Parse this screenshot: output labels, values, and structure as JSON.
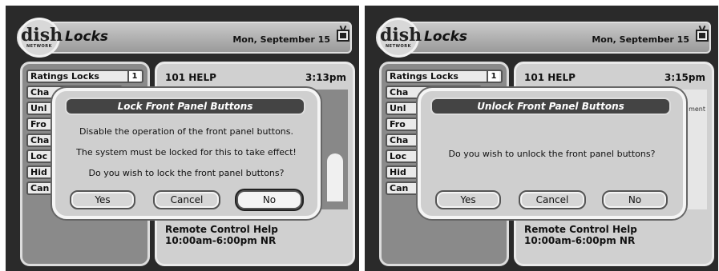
{
  "left": {
    "title": "Locks",
    "date": "Mon, September 15",
    "menu": [
      {
        "label": "Ratings Locks",
        "num": "1"
      },
      {
        "label": "Cha"
      },
      {
        "label": "Unl"
      },
      {
        "label": "Fro"
      },
      {
        "label": "Cha"
      },
      {
        "label": "Loc"
      },
      {
        "label": "Hid"
      },
      {
        "label": "Can"
      }
    ],
    "help": {
      "title": "101 HELP",
      "time": "3:13pm",
      "bottom_line1": "Remote Control Help",
      "bottom_line2": "10:00am-6:00pm NR"
    },
    "dialog": {
      "title": "Lock Front Panel Buttons",
      "line1": "Disable the operation of the front panel buttons.",
      "line2": "The system must be locked for this to take effect!",
      "line3": "Do you wish to lock the front panel buttons?",
      "yes": "Yes",
      "cancel": "Cancel",
      "no": "No"
    }
  },
  "right": {
    "title": "Locks",
    "date": "Mon, September 15",
    "menu": [
      {
        "label": "Ratings Locks",
        "num": "1"
      },
      {
        "label": "Cha"
      },
      {
        "label": "Unl"
      },
      {
        "label": "Fro"
      },
      {
        "label": "Cha"
      },
      {
        "label": "Loc"
      },
      {
        "label": "Hid"
      },
      {
        "label": "Can"
      }
    ],
    "help": {
      "title": "101 HELP",
      "time": "3:15pm",
      "side_text": "ment",
      "bottom_line1": "Remote Control Help",
      "bottom_line2": "10:00am-6:00pm NR"
    },
    "dialog": {
      "title": "Unlock Front Panel Buttons",
      "line1": "Do you wish to unlock the front panel buttons?",
      "yes": "Yes",
      "cancel": "Cancel",
      "no": "No"
    }
  },
  "logo": {
    "text": "dish",
    "sub": "NETWORK"
  },
  "icons": {
    "tv": "tv-icon"
  }
}
